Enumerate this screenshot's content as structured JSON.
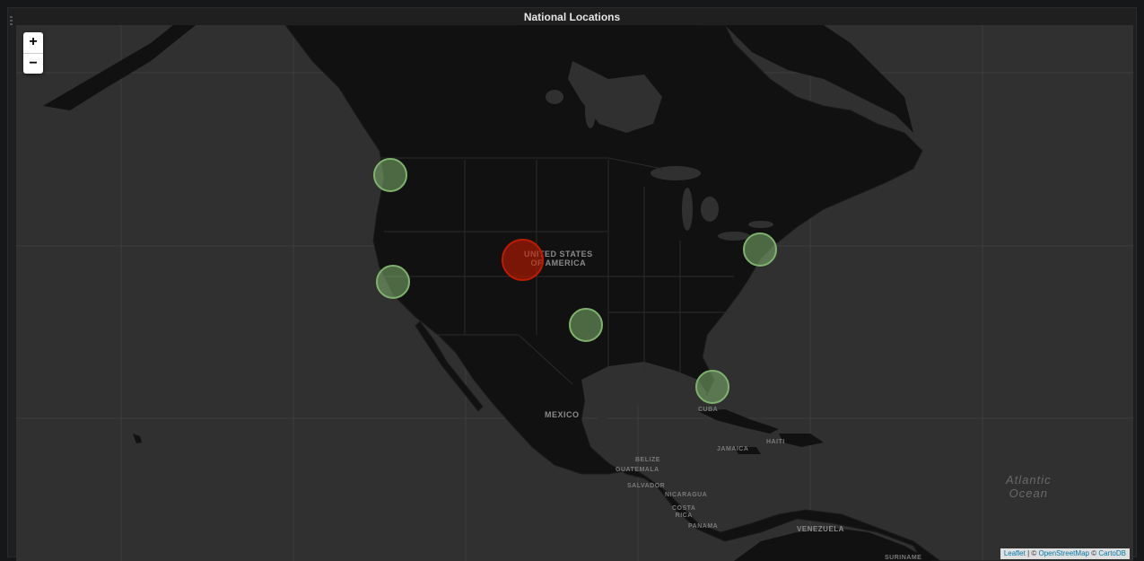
{
  "panel": {
    "title": "National Locations"
  },
  "zoom": {
    "in_label": "+",
    "out_label": "−"
  },
  "attribution": {
    "leaflet": "Leaflet",
    "sep1": " | © ",
    "osm": "OpenStreetMap",
    "sep2": " © ",
    "carto": "CartoDB"
  },
  "map_labels": {
    "usa_line1": "UNITED STATES",
    "usa_line2": "OF AMERICA",
    "mexico": "MEXICO",
    "cuba": "CUBA",
    "haiti": "HAITI",
    "jamaica": "JAMAICA",
    "belize": "BELIZE",
    "guatemala": "GUATEMALA",
    "el_salvador": "SALVADOR",
    "nicaragua": "NICARAGUA",
    "costa_rica_1": "COSTA",
    "costa_rica_2": "RICA",
    "panama": "PANAMA",
    "venezuela": "VENEZUELA",
    "suriname": "SURINAME",
    "atlantic_1": "Atlantic",
    "atlantic_2": "Ocean"
  },
  "markers": [
    {
      "name": "marker-portland",
      "status": "ok",
      "color": "#7eb26d"
    },
    {
      "name": "marker-san-francisco",
      "status": "ok",
      "color": "#7eb26d"
    },
    {
      "name": "marker-denver",
      "status": "alert",
      "color": "#bf1b00"
    },
    {
      "name": "marker-dallas",
      "status": "ok",
      "color": "#7eb26d"
    },
    {
      "name": "marker-new-york",
      "status": "ok",
      "color": "#7eb26d"
    },
    {
      "name": "marker-miami",
      "status": "ok",
      "color": "#7eb26d"
    }
  ],
  "colors": {
    "background": "#161719",
    "panel": "#1f1f20",
    "water": "#303030",
    "land": "#111111",
    "ok": "#7eb26d",
    "alert": "#bf1b00"
  }
}
